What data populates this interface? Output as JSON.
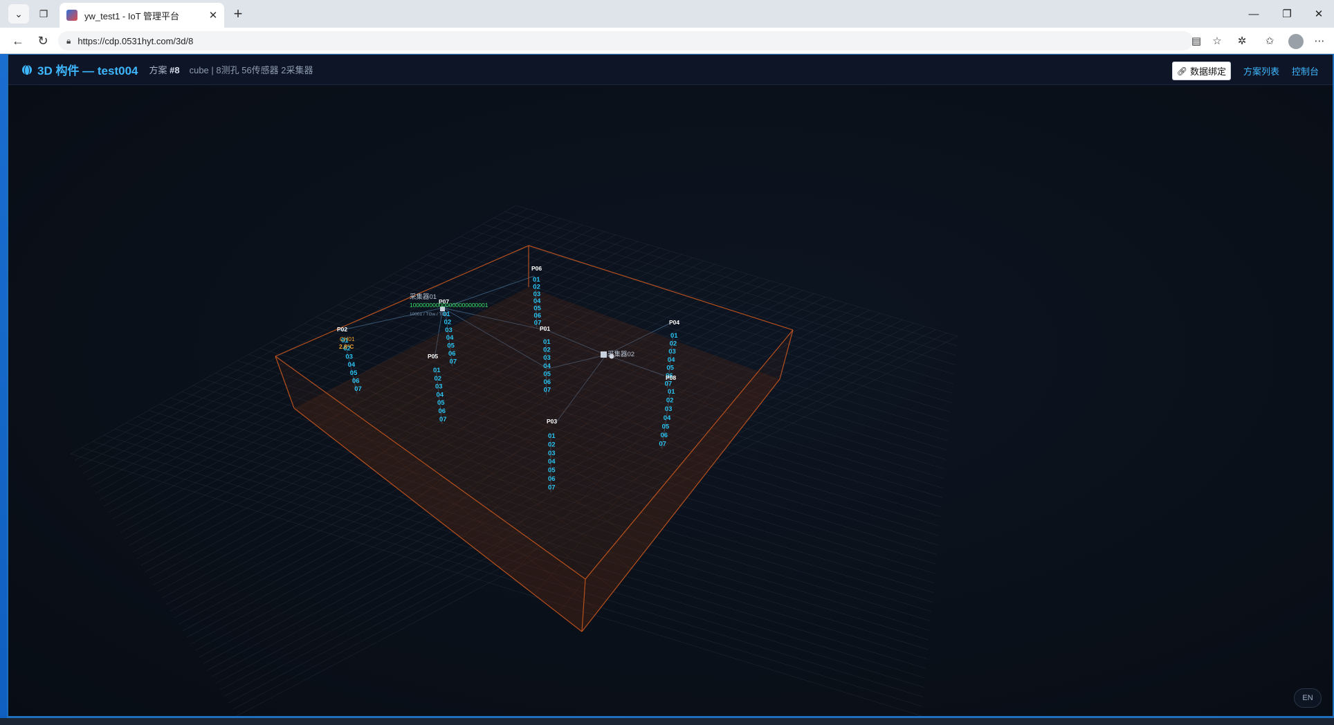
{
  "browser": {
    "tab_title": "yw_test1 - IoT 管理平台",
    "url": "https://cdp.0531hyt.com/3d/8"
  },
  "header": {
    "title": "3D 构件 — test004",
    "plan_label": "方案 ",
    "plan_id": "#8",
    "description": "cube | 8测孔 56传感器 2采集器",
    "bind_button": "数据绑定",
    "link_plan_list": "方案列表",
    "link_console": "控制台"
  },
  "language_button": "EN",
  "scene": {
    "colors": {
      "box_edge": "#c8561e",
      "grid": "#2b3646",
      "hole_label": "#ffffff",
      "sensor_label": "#29c4f2",
      "collector_label": "#b9c5d3",
      "highlight_value": "#f2a22a",
      "device_id": "#3be36a"
    },
    "collectors": [
      {
        "name": "采集器01",
        "device_id": "100000000000000000000001",
        "sub": "10001 / TGw / TG1"
      },
      {
        "name": "采集器02"
      }
    ],
    "holes": [
      {
        "name": "P02",
        "sensors": [
          "01",
          "02",
          "03",
          "04",
          "05",
          "06",
          "07"
        ],
        "highlight": {
          "channel": "CH01",
          "value": "2.8°C"
        }
      },
      {
        "name": "P07",
        "sensors": [
          "01",
          "02",
          "03",
          "04",
          "05",
          "06",
          "07"
        ]
      },
      {
        "name": "P05",
        "sensors": [
          "01",
          "02",
          "03",
          "04",
          "05",
          "06",
          "07"
        ]
      },
      {
        "name": "P06",
        "sensors": [
          "01",
          "02",
          "03",
          "04",
          "05",
          "06",
          "07"
        ]
      },
      {
        "name": "P01",
        "sensors": [
          "01",
          "02",
          "03",
          "04",
          "05",
          "06",
          "07"
        ]
      },
      {
        "name": "P04",
        "sensors": [
          "01",
          "02",
          "03",
          "04",
          "05",
          "06",
          "07"
        ]
      },
      {
        "name": "P08",
        "sensors": [
          "01",
          "02",
          "03",
          "04",
          "05",
          "06",
          "07"
        ]
      },
      {
        "name": "P03",
        "sensors": [
          "01",
          "02",
          "03",
          "04",
          "05",
          "06",
          "07"
        ]
      }
    ]
  }
}
